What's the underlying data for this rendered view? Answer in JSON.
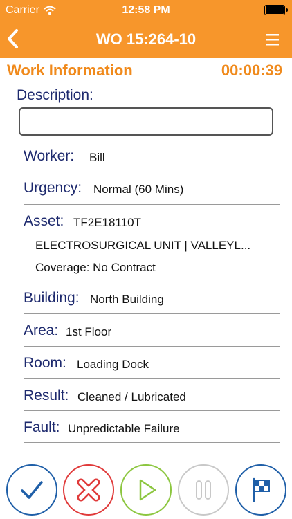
{
  "status_bar": {
    "carrier": "Carrier",
    "time": "12:58 PM"
  },
  "nav": {
    "title": "WO 15:264-10"
  },
  "section": {
    "title": "Work Information",
    "timer": "00:00:39"
  },
  "description": {
    "label": "Description:",
    "value": ""
  },
  "fields": {
    "worker": {
      "label": "Worker:",
      "value": "Bill"
    },
    "urgency": {
      "label": "Urgency:",
      "value": "Normal (60 Mins)"
    },
    "asset": {
      "label": "Asset:",
      "value": "TF2E18110T",
      "detail": "ELECTROSURGICAL UNIT | VALLEYL...",
      "coverage": "Coverage: No Contract"
    },
    "building": {
      "label": "Building:",
      "value": "North Building"
    },
    "area": {
      "label": "Area:",
      "value": "1st Floor"
    },
    "room": {
      "label": "Room:",
      "value": "Loading Dock"
    },
    "result": {
      "label": "Result:",
      "value": "Cleaned / Lubricated"
    },
    "fault": {
      "label": "Fault:",
      "value": "Unpredictable Failure"
    }
  },
  "colors": {
    "brand_orange": "#f7962b",
    "label_navy": "#1e2a6e",
    "complete_blue": "#1f5fa8",
    "cancel_red": "#e03a3a",
    "start_green": "#8cc63f",
    "pause_gray": "#c8c8c8"
  }
}
